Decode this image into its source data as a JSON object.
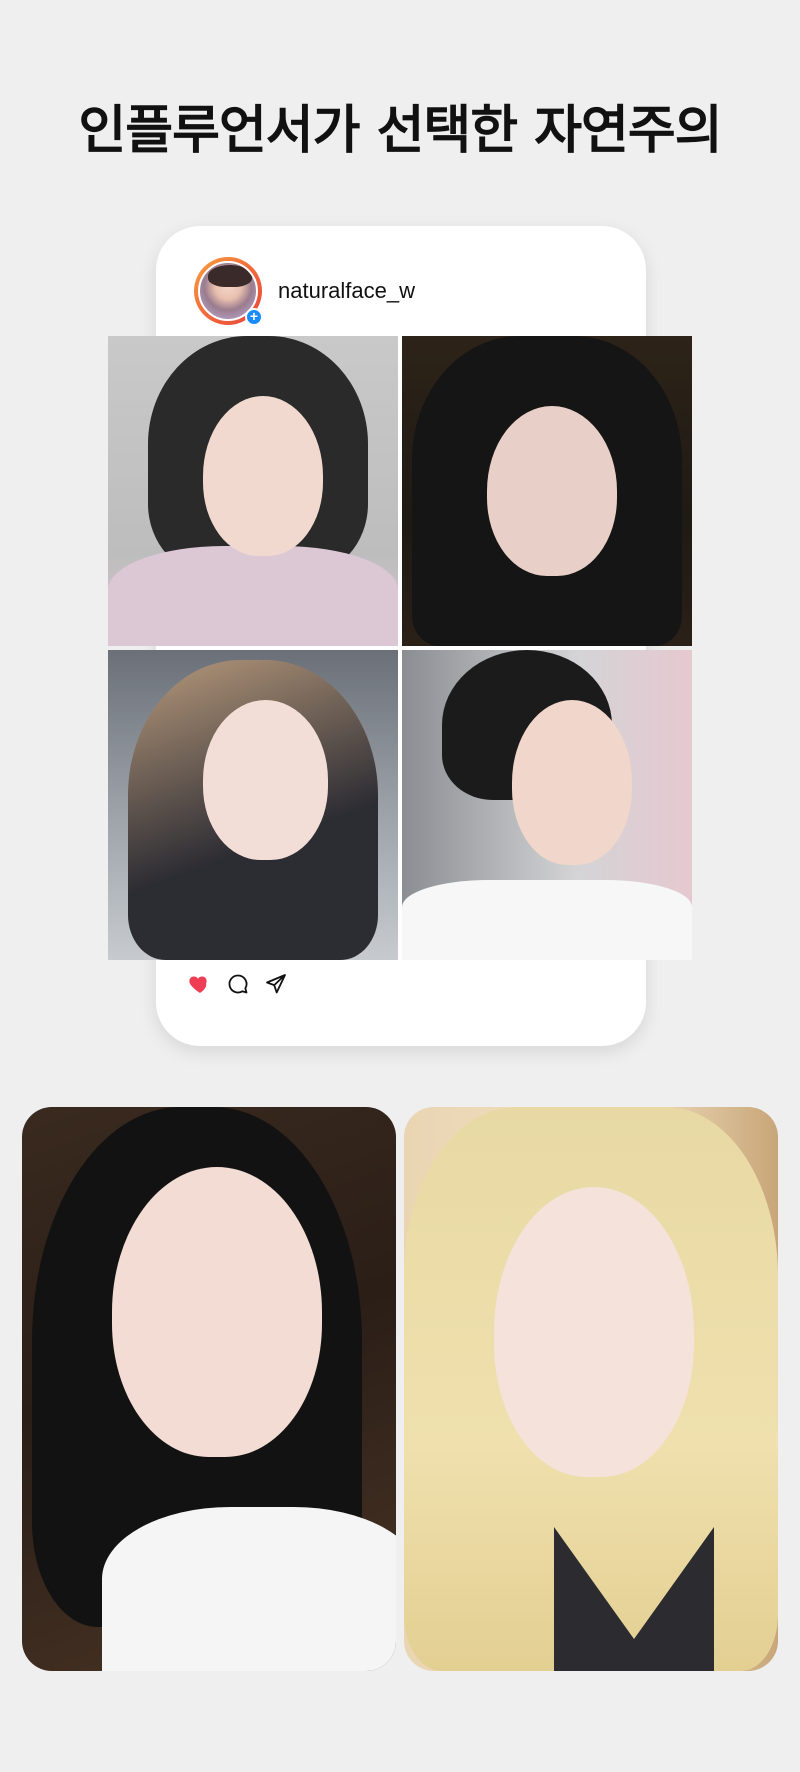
{
  "headline": "인플루언서가 선택한 자연주의",
  "post": {
    "username": "naturalface_w",
    "avatar_badge": "+",
    "photos": [
      {
        "label": "photo-1"
      },
      {
        "label": "photo-2"
      },
      {
        "label": "photo-3"
      },
      {
        "label": "photo-4"
      }
    ],
    "actions": {
      "like_icon": "heart-icon",
      "comment_icon": "comment-icon",
      "share_icon": "send-icon"
    }
  },
  "colors": {
    "background": "#efefef",
    "card": "#ffffff",
    "like_red": "#ef3d54",
    "avatar_ring": "#f26a3a",
    "plus_badge": "#1a8cff"
  }
}
